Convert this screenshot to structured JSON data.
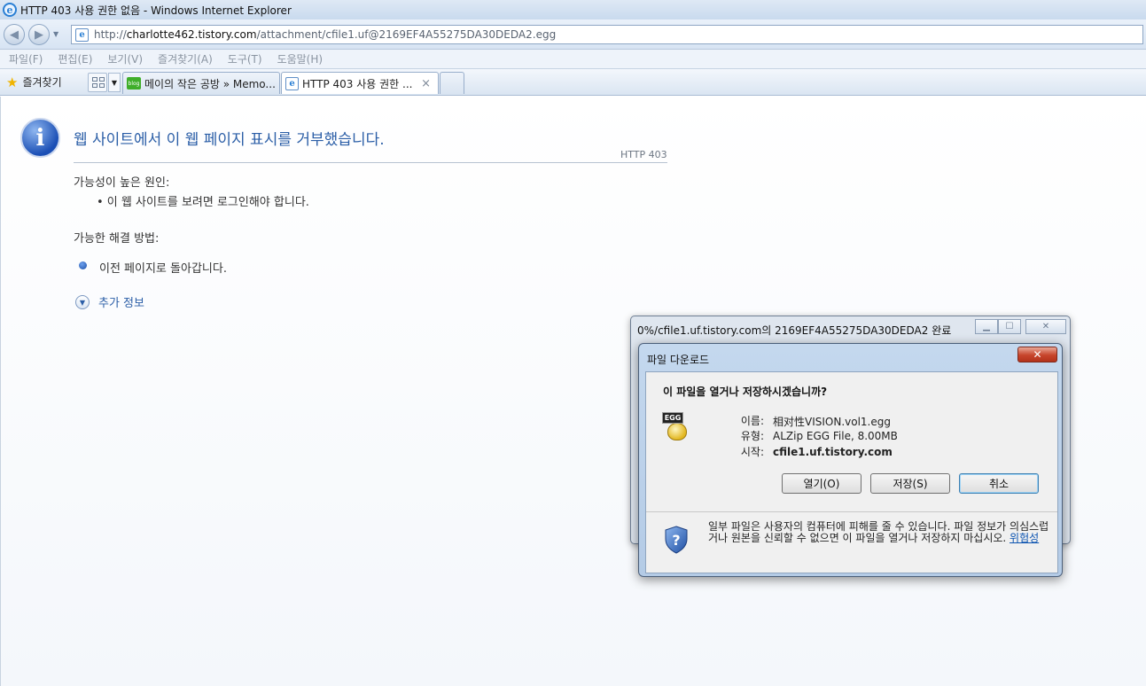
{
  "window": {
    "title": "HTTP 403 사용 권한 없음 - Windows Internet Explorer"
  },
  "address_bar": {
    "url_prefix": "http://",
    "url_host": "charlotte462.tistory.com",
    "url_path": "/attachment/cfile1.uf@2169EF4A55275DA30DEDA2.egg"
  },
  "menu": [
    "파일(F)",
    "편집(E)",
    "보기(V)",
    "즐겨찾기(A)",
    "도구(T)",
    "도움말(H)"
  ],
  "favorites_label": "즐겨찾기",
  "tabs": [
    {
      "label": "메이의 작은 공방 » Memo...",
      "icon": "blog-icon"
    },
    {
      "label": "HTTP 403 사용 권한 ...",
      "icon": "ie-page-icon",
      "close": "×"
    }
  ],
  "page": {
    "heading": "웹 사이트에서 이 웹 페이지 표시를 거부했습니다.",
    "http_code": "HTTP 403",
    "cause_title": "가능성이 높은 원인:",
    "cause_item": "•  이 웹 사이트를 보려면 로그인해야 합니다.",
    "solution_title": "가능한 해결 방법:",
    "solution_item": "이전 페이지로 돌아갑니다.",
    "more_info": "추가 정보"
  },
  "progress_window": {
    "title": "0%/cfile1.uf.tistory.com의 2169EF4A55275DA30DEDA2  완료"
  },
  "download_dialog": {
    "title": "파일 다운로드",
    "question": "이 파일을 열거나 저장하시겠습니까?",
    "icon_label": "EGG",
    "name_label": "이름:",
    "name_value": "相对性VISION.vol1.egg",
    "type_label": "유형:",
    "type_value": "ALZip EGG File, 8.00MB",
    "from_label": "시작:",
    "from_value": "cfile1.uf.tistory.com",
    "buttons": {
      "open": "열기(O)",
      "save": "저장(S)",
      "cancel": "취소"
    },
    "warning": "일부 파일은 사용자의 컴퓨터에 피해를 줄 수 있습니다. 파일 정보가 의심스럽거나 원본을 신뢰할 수 없으면 이 파일을 열거나 저장하지 마십시오. ",
    "risk_link": "위험성"
  },
  "colors": {
    "heading_blue": "#2b5ea7",
    "close_red": "#c7442b",
    "link_blue": "#0b53b0"
  }
}
